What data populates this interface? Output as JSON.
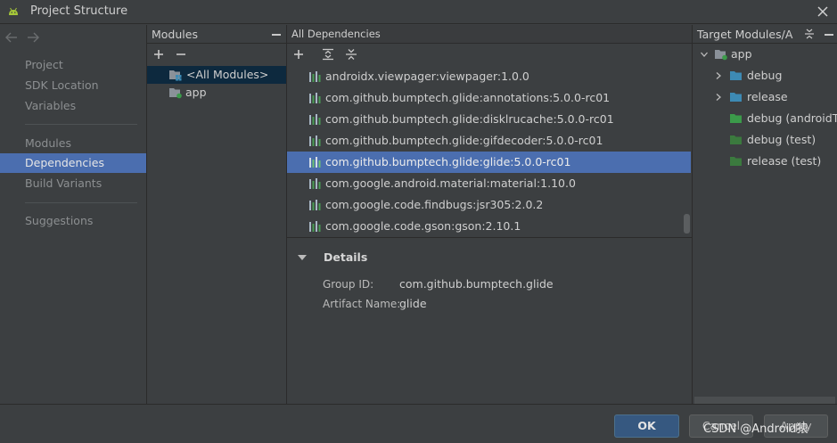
{
  "window": {
    "title": "Project Structure"
  },
  "nav": {
    "items": [
      {
        "label": "Project"
      },
      {
        "label": "SDK Location"
      },
      {
        "label": "Variables"
      },
      {
        "label": "Modules"
      },
      {
        "label": "Dependencies"
      },
      {
        "label": "Build Variants"
      },
      {
        "label": "Suggestions"
      }
    ],
    "selected": "Dependencies"
  },
  "modules": {
    "header": "Modules",
    "items": [
      {
        "label": "<All Modules>"
      },
      {
        "label": "app"
      }
    ]
  },
  "dependencies": {
    "header": "All Dependencies",
    "items": [
      {
        "label": "androidx.viewpager:viewpager:1.0.0"
      },
      {
        "label": "com.github.bumptech.glide:annotations:5.0.0-rc01"
      },
      {
        "label": "com.github.bumptech.glide:disklrucache:5.0.0-rc01"
      },
      {
        "label": "com.github.bumptech.glide:gifdecoder:5.0.0-rc01"
      },
      {
        "label": "com.github.bumptech.glide:glide:5.0.0-rc01"
      },
      {
        "label": "com.google.android.material:material:1.10.0"
      },
      {
        "label": "com.google.code.findbugs:jsr305:2.0.2"
      },
      {
        "label": "com.google.code.gson:gson:2.10.1"
      }
    ],
    "selected": "com.github.bumptech.glide:glide:5.0.0-rc01"
  },
  "details": {
    "header": "Details",
    "group_id_label": "Group ID:",
    "group_id": "com.github.bumptech.glide",
    "artifact_label": "Artifact Name:",
    "artifact": "glide"
  },
  "targets": {
    "header": "Target Modules/A",
    "root": "app",
    "items": [
      {
        "label": "debug"
      },
      {
        "label": "release"
      },
      {
        "label": "debug (androidTest)"
      },
      {
        "label": "debug (test)"
      },
      {
        "label": "release (test)"
      }
    ]
  },
  "buttons": {
    "ok": "OK",
    "cancel": "Cancel",
    "apply": "Apply"
  },
  "watermark": "CSDN @Android猿",
  "colors": {
    "selection": "#4b6eaf",
    "module_selection": "#0d293e",
    "primary_button": "#365880",
    "android_green": "#a4c639",
    "source_folder_green": "#3b9b4a",
    "folder_blue": "#3d8ab4"
  }
}
